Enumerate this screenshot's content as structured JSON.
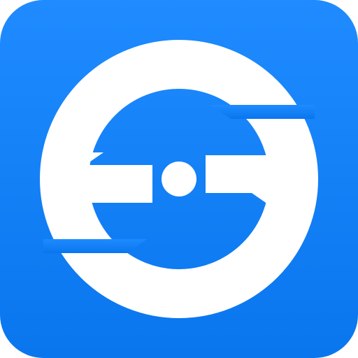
{
  "icon": {
    "name": "app-logo-icon",
    "shape": "rounded-square",
    "colors": {
      "background_top": "#1f8bff",
      "background_bottom": "#0a76ee",
      "glyph": "#ffffff"
    }
  }
}
